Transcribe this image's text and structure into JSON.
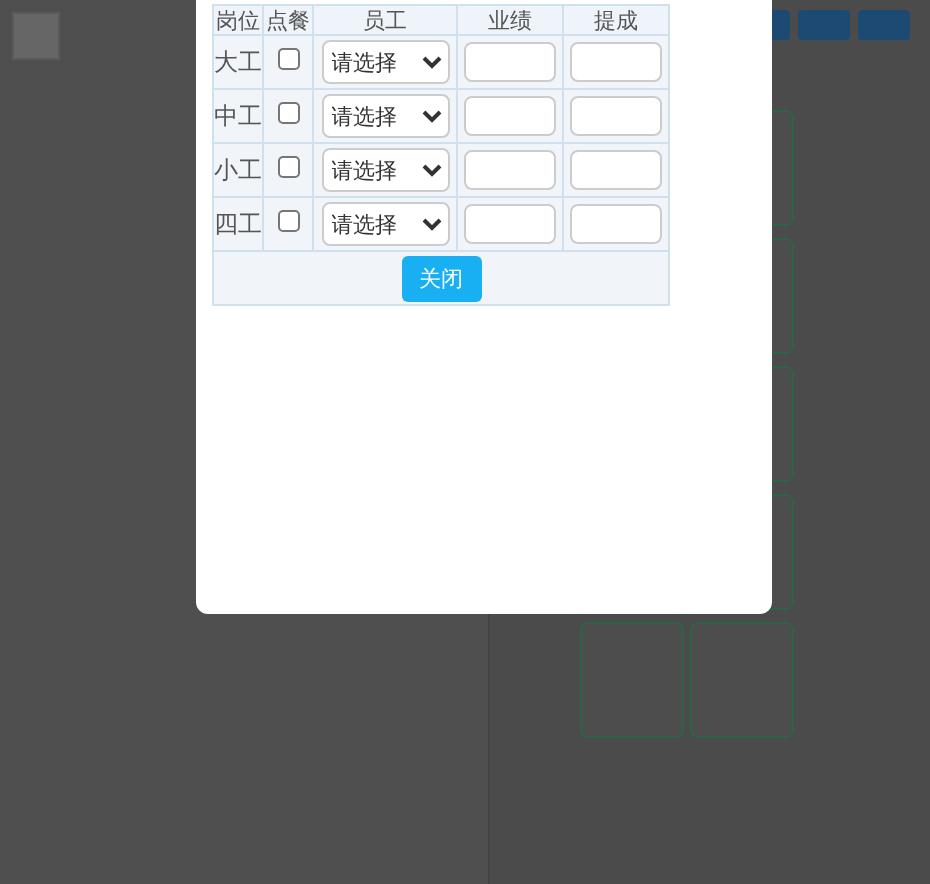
{
  "dialog": {
    "table": {
      "columns": [
        "岗位",
        "点餐",
        "员工",
        "业绩",
        "提成"
      ],
      "rows": [
        {
          "position": "大工",
          "checked": false,
          "employee": "请选择",
          "performance": "",
          "commission": ""
        },
        {
          "position": "中工",
          "checked": false,
          "employee": "请选择",
          "performance": "",
          "commission": ""
        },
        {
          "position": "小工",
          "checked": false,
          "employee": "请选择",
          "performance": "",
          "commission": ""
        },
        {
          "position": "四工",
          "checked": false,
          "employee": "请选择",
          "performance": "",
          "commission": ""
        }
      ]
    },
    "close_button": "关闭"
  }
}
